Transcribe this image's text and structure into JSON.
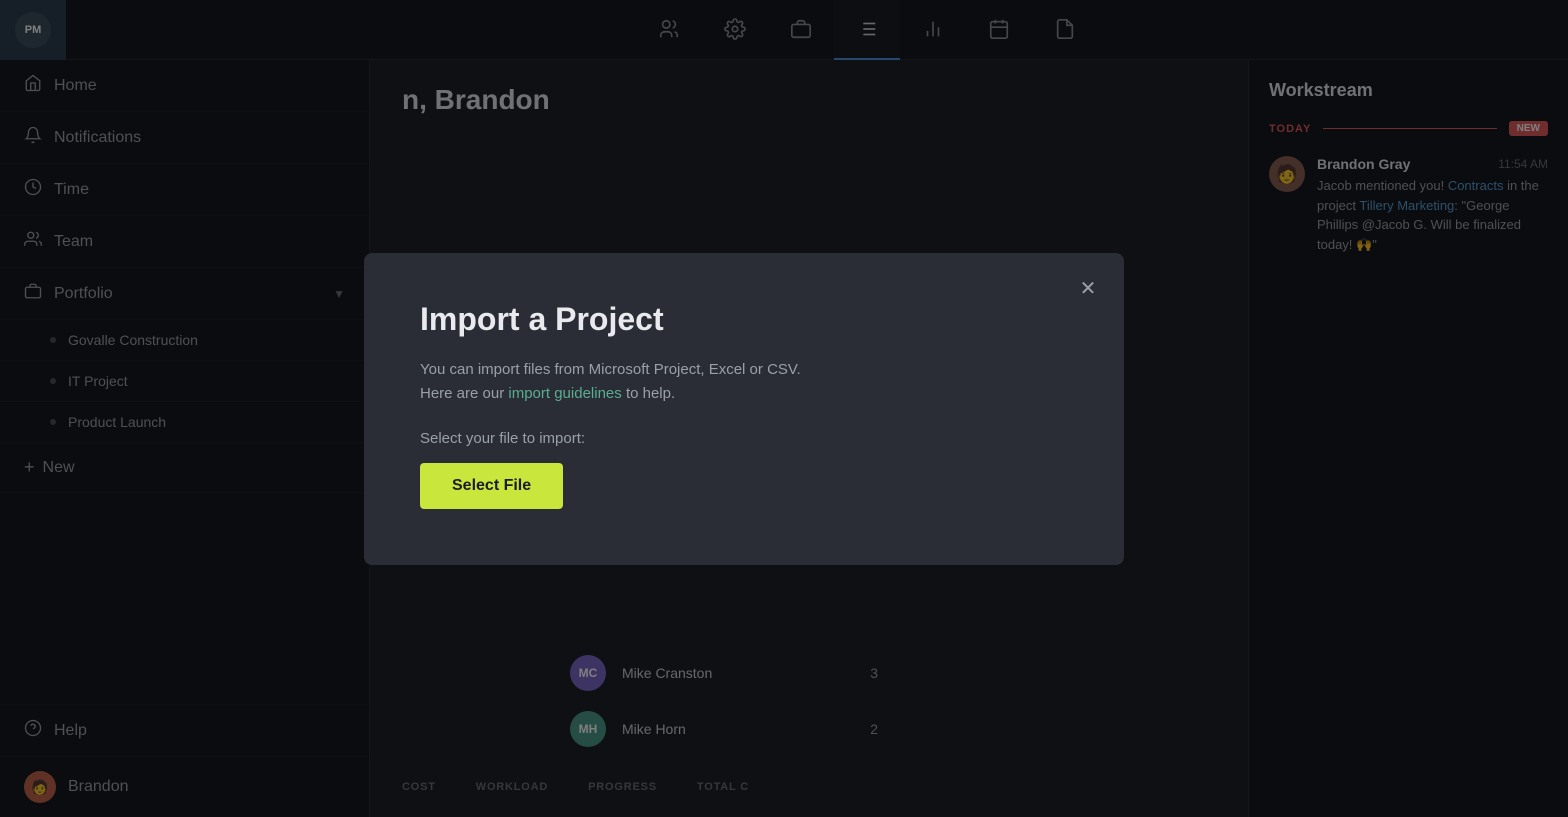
{
  "app": {
    "logo": "PM",
    "title": "n, Brandon"
  },
  "topnav": {
    "icons": [
      {
        "id": "people-icon",
        "symbol": "👥",
        "active": false
      },
      {
        "id": "settings-icon",
        "symbol": "⚙️",
        "active": false
      },
      {
        "id": "portfolio-icon",
        "symbol": "💼",
        "active": false
      },
      {
        "id": "list-icon",
        "symbol": "☰",
        "active": true
      },
      {
        "id": "chart-icon",
        "symbol": "📊",
        "active": false
      },
      {
        "id": "calendar-icon",
        "symbol": "📅",
        "active": false
      },
      {
        "id": "file-icon",
        "symbol": "📄",
        "active": false
      }
    ]
  },
  "sidebar": {
    "home_label": "Home",
    "notifications_label": "Notifications",
    "time_label": "Time",
    "team_label": "Team",
    "portfolio_label": "Portfolio",
    "portfolio_items": [
      {
        "id": "govalle",
        "label": "Govalle Construction"
      },
      {
        "id": "it-project",
        "label": "IT Project"
      },
      {
        "id": "product-launch",
        "label": "Product Launch"
      }
    ],
    "new_label": "New",
    "help_label": "Help",
    "user_label": "Brandon",
    "user_emoji": "🧑"
  },
  "workstream": {
    "title": "Workstream",
    "today_label": "TODAY",
    "new_badge": "NEW",
    "notifications": [
      {
        "id": "notif-1",
        "name": "Brandon Gray",
        "time": "11:54 AM",
        "avatar_emoji": "🧑",
        "text_before": "Jacob mentioned you! ",
        "link1_text": "Contracts",
        "text_middle": " in the project ",
        "link2_text": "Tillery Marketing",
        "text_after": ": \"George Phillips @Jacob G. Will be finalized today! 🙌\""
      }
    ]
  },
  "table": {
    "columns": [
      "COST",
      "WORKLOAD",
      "PROGRESS",
      "TOTAL C"
    ],
    "members": [
      {
        "id": "mike-cranston",
        "initials": "MC",
        "name": "Mike Cranston",
        "count": 3,
        "avatar_color": "#7b68c8"
      },
      {
        "id": "mike-horn",
        "initials": "MH",
        "name": "Mike Horn",
        "count": 2,
        "avatar_color": "#4a9a8a"
      }
    ]
  },
  "modal": {
    "title": "Import a Project",
    "description_before": "You can import files from Microsoft Project, Excel or CSV.\nHere are our ",
    "link_text": "import guidelines",
    "description_after": " to help.",
    "select_label": "Select your file to import:",
    "select_button": "Select File",
    "close_label": "✕"
  }
}
